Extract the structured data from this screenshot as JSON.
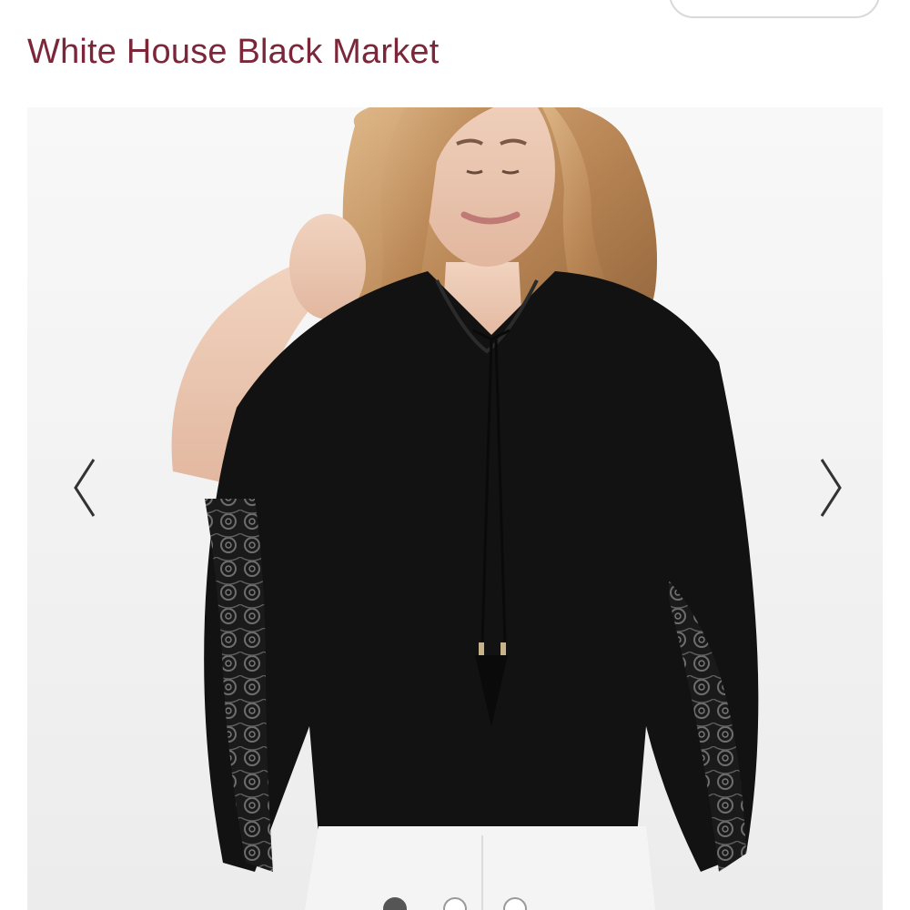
{
  "header": {
    "brand": "White House Black Market"
  },
  "gallery": {
    "image_alt": "Model wearing black poncho top with lace trim",
    "prev_icon": "chevron-left-icon",
    "next_icon": "chevron-right-icon",
    "slide_count": 3,
    "active_slide": 1
  },
  "colors": {
    "brand": "#7b2639",
    "garment": "#121212"
  }
}
